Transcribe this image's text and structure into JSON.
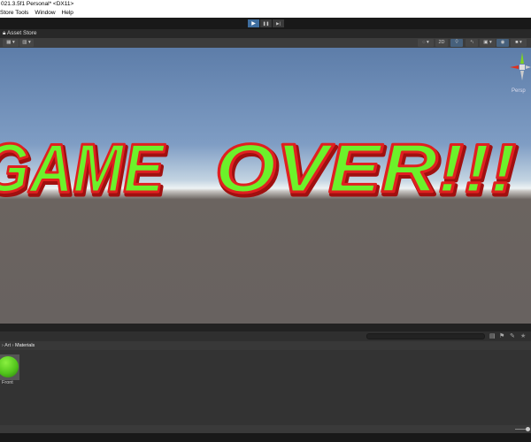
{
  "window": {
    "title": "021.3.5f1 Personal* <DX11>"
  },
  "menu": [
    "Store Tools",
    "Window",
    "Help"
  ],
  "toolbar": {
    "play": "▶",
    "pause": "❚❚",
    "step": "▶|"
  },
  "tabs": [
    {
      "label": "Asset Store"
    }
  ],
  "scene_toolbar": {
    "mode_2d": "2D",
    "gizmo_label": "Persp"
  },
  "scene": {
    "text_part1": "GAME",
    "text_part2": "OVER!!!",
    "fill": "#6cf22a",
    "stroke": "#e02020"
  },
  "project": {
    "breadcrumb": [
      "Art",
      "Materials"
    ],
    "assets": [
      {
        "name": "Front",
        "color": "#5fd324"
      }
    ]
  }
}
